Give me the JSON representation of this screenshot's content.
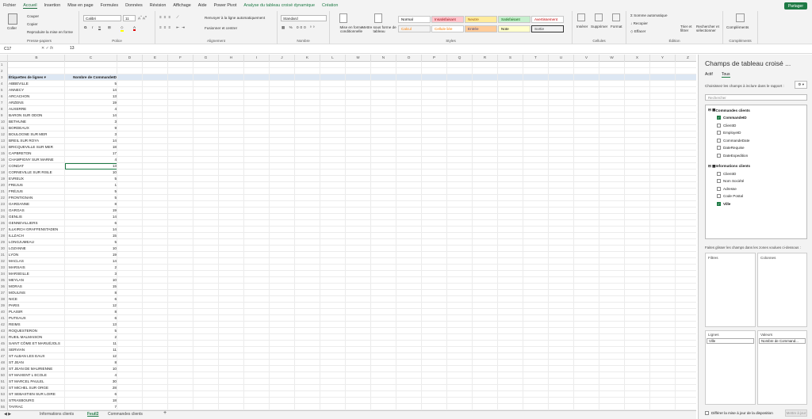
{
  "ribbon_tabs": [
    "Fichier",
    "Accueil",
    "Insertion",
    "Mise en page",
    "Formules",
    "Données",
    "Révision",
    "Affichage",
    "Aide",
    "Power Pivot",
    "Analyse du tableau croisé dynamique",
    "Création"
  ],
  "share_label": "Partager",
  "clipboard": {
    "paste": "Coller",
    "cut": "Couper",
    "copy": "Copier",
    "format_painter": "Reproduire la mise en forme",
    "label": "Presse-papiers"
  },
  "font": {
    "name": "Calibri",
    "size": "11",
    "label": "Police"
  },
  "alignment": {
    "wrap": "Renvoyer à la ligne automatiquement",
    "merge": "Fusionner et centrer",
    "label": "Alignement"
  },
  "number": {
    "format": "Standard",
    "label": "Nombre"
  },
  "styles": {
    "cond": "Mise en forme conditionnelle",
    "table": "Mettre sous forme de tableau",
    "items": [
      "Normal",
      "Insatisfaisant",
      "Neutre",
      "Satisfaisant",
      "Avertissement",
      "Calcul",
      "Cellule liée",
      "Entrée",
      "Note",
      "Sortie"
    ],
    "label": "Styles"
  },
  "cells": {
    "insert": "Insérer",
    "delete": "Supprimer",
    "format": "Format",
    "label": "Cellules"
  },
  "editing": {
    "autosum": "Somme automatique",
    "fill": "Recopier",
    "clear": "Effacer",
    "sort": "Trier et filtrer",
    "find": "Rechercher et sélectionner",
    "label": "Édition"
  },
  "addins": {
    "btn": "Compléments",
    "label": "Compléments"
  },
  "formula_bar": {
    "cell": "C17",
    "fx": "fx",
    "value": "13"
  },
  "columns": [
    "A",
    "B",
    "C",
    "D",
    "E",
    "F",
    "G",
    "H",
    "I",
    "J",
    "K",
    "L",
    "M",
    "N",
    "O",
    "P",
    "Q",
    "R",
    "S",
    "T",
    "U",
    "V",
    "W",
    "X",
    "Y",
    "Z"
  ],
  "pivot": {
    "header_label": "Étiquettes de lignes",
    "header_value": "Nombre de CommandeID",
    "rows": [
      [
        "ABBEVILLE",
        "5"
      ],
      [
        "ANNECY",
        "14"
      ],
      [
        "ARCACHON",
        "13"
      ],
      [
        "ARZENS",
        "19"
      ],
      [
        "AUXERRE",
        "4"
      ],
      [
        "BARON SUR ODON",
        "14"
      ],
      [
        "BETHUNE",
        "3"
      ],
      [
        "BORDEAUX",
        "9"
      ],
      [
        "BOULOGNE SUR MER",
        "3"
      ],
      [
        "BREIL SUR ROYA",
        "14"
      ],
      [
        "BRICQUEVILLE SUR MER",
        "18"
      ],
      [
        "CAPBRETON",
        "17"
      ],
      [
        "CHAMPIGNY SUR MARNE",
        "4"
      ],
      [
        "CONDAT",
        "13"
      ],
      [
        "CORNEVILLE SUR RISLE",
        "10"
      ],
      [
        "EVREUX",
        "5"
      ],
      [
        "FREJUS",
        "1"
      ],
      [
        "FRÉJUS",
        "5"
      ],
      [
        "FRONTIGNAN",
        "5"
      ],
      [
        "GARDANNE",
        "8"
      ],
      [
        "GARGAS",
        "19"
      ],
      [
        "GENLIS",
        "14"
      ],
      [
        "GENNEVILLIERS",
        "6"
      ],
      [
        "ILLKIRCH GRAFFENSTADEN",
        "14"
      ],
      [
        "ILLZACH",
        "15"
      ],
      [
        "LONGJUMEAU",
        "5"
      ],
      [
        "LOZANNE",
        "10"
      ],
      [
        "LYON",
        "19"
      ],
      [
        "MACLAS",
        "14"
      ],
      [
        "MARSAIS",
        "2"
      ],
      [
        "MARSEILLE",
        "3"
      ],
      [
        "MEYLAN",
        "10"
      ],
      [
        "MORAS",
        "15"
      ],
      [
        "MOULINS",
        "8"
      ],
      [
        "NICE",
        "6"
      ],
      [
        "PARIS",
        "12"
      ],
      [
        "PLAISIR",
        "8"
      ],
      [
        "PUTEAUX",
        "6"
      ],
      [
        "REIMS",
        "13"
      ],
      [
        "ROQUESTERON",
        "5"
      ],
      [
        "RUEIL MALMAISON",
        "2"
      ],
      [
        "SAINT CÔME ET MARUÉJOLS",
        "11"
      ],
      [
        "SERVIAN",
        "11"
      ],
      [
        "ST ALBAN LES EAUX",
        "12"
      ],
      [
        "ST JEAN",
        "8"
      ],
      [
        "ST JEAN DE MAURIENNE",
        "10"
      ],
      [
        "ST MAIXENT L ECOLE",
        "4"
      ],
      [
        "ST MARCEL PAULEL",
        "30"
      ],
      [
        "ST MICHEL SUR ORGE",
        "28"
      ],
      [
        "ST SEBASTIEN SUR LOIRE",
        "6"
      ],
      [
        "STRASBOURG",
        "18"
      ],
      [
        "TAYRAC",
        "7"
      ]
    ]
  },
  "sheet_tabs": [
    "Informations clients",
    "Feuil2",
    "Commandes clients"
  ],
  "pane": {
    "title": "Champs de tableau croisé ...",
    "tab_active": "Actif",
    "tab_all": "Tous",
    "hint": "Choisissez les champs à inclure dans le rapport :",
    "search": "Rechercher",
    "groups": [
      {
        "name": "Commandes clients",
        "fields": [
          [
            "CommandeID",
            true
          ],
          [
            "ClientID",
            false
          ],
          [
            "EmployeID",
            false
          ],
          [
            "CommandeDate",
            false
          ],
          [
            "DateRequise",
            false
          ],
          [
            "DateExpedition",
            false
          ]
        ]
      },
      {
        "name": "Informations clients",
        "fields": [
          [
            "ClientID",
            false
          ],
          [
            "Nom Société",
            false
          ],
          [
            "Adresse",
            false
          ],
          [
            "Code Postal",
            false
          ],
          [
            "Ville",
            true
          ]
        ]
      }
    ],
    "drag_hint": "Faites glisser les champs dans les zones voulues ci-dessous :",
    "filters": "Filtres",
    "columns": "Colonnes",
    "rows": "Lignes",
    "values": "Valeurs",
    "row_field": "Ville",
    "value_field": "Nombre de Command...",
    "defer": "Différer la mise à jour de la disposition",
    "update": "Mettre à jour"
  }
}
